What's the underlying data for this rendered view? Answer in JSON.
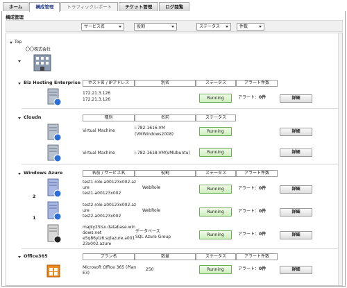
{
  "tabs": [
    {
      "label": "ホーム"
    },
    {
      "label": "構成管理"
    },
    {
      "label": "トラフィックレポート"
    },
    {
      "label": "チケット管理"
    },
    {
      "label": "ログ閲覧"
    }
  ],
  "section_title": "構成管理",
  "filters": {
    "service": "サービス名",
    "role": "役割",
    "status": "ステータス",
    "count": "件数"
  },
  "tree": {
    "root": "Top",
    "company": "〇〇株式会社"
  },
  "groups": {
    "biz": {
      "name": "Biz Hosting Enterprise",
      "headers": [
        "ホスト名 / IPアドレス",
        "別名",
        "ステータス",
        "アラート件数"
      ],
      "rows": [
        {
          "host1": "172.21.3.126",
          "host2": "172.21.3.126",
          "status": "Running",
          "alert_label": "アラート：",
          "alert_count": "0件",
          "detail": "詳細"
        }
      ]
    },
    "cloudn": {
      "name": "Cloudn",
      "headers": [
        "種別",
        "名前",
        "ステータス"
      ],
      "rows": [
        {
          "type": "Virtual Machine",
          "name1": "i-782-1616-VM",
          "name2": "(VMWindows2008)",
          "status": "Running",
          "detail": "詳細"
        },
        {
          "type": "Virtual Machine",
          "name1": "i-782-1618-VM(VMUbuntu)",
          "status": "Running",
          "detail": "詳細"
        }
      ]
    },
    "azure": {
      "name": "Windows Azure",
      "headers": [
        "名前 / サービス名",
        "役割",
        "ステータス",
        "アラート件数"
      ],
      "rows": [
        {
          "badge": "2",
          "l1": "test1.role.a00123x002.az",
          "l2": "ure",
          "l3": "test1-a00123x002",
          "role": "WebRole",
          "status": "Running",
          "alert_label": "アラート：",
          "alert_count": "0件",
          "detail": "詳細"
        },
        {
          "badge": "1",
          "l1": "test2.role.a00123x002.az",
          "l2": "ure",
          "l3": "test2-a00123x002",
          "role": "WebRole",
          "status": "Running",
          "alert_label": "アラート：",
          "alert_count": "0件",
          "detail": "詳細"
        },
        {
          "l1": "majky25lsx.database.win",
          "l2": "dows.net",
          "l3": "e5q86ylz6.sqlazure.a001",
          "l4": "23x002.azure",
          "role1": "データベース",
          "role2": "SQL Azure Group",
          "status": "Running",
          "alert_label": "アラート：",
          "alert_count": "0件",
          "detail": "詳細"
        }
      ]
    },
    "office": {
      "name": "Office365",
      "headers": [
        "プラン名",
        "数量",
        "ステータス",
        "アラート件数"
      ],
      "rows": [
        {
          "plan1": "Microsoft Office 365 (Plan",
          "plan2": "E3)",
          "qty": "250",
          "status": "Running",
          "alert_label": "アラート：",
          "alert_count": "0件",
          "detail": "詳細"
        }
      ]
    }
  }
}
